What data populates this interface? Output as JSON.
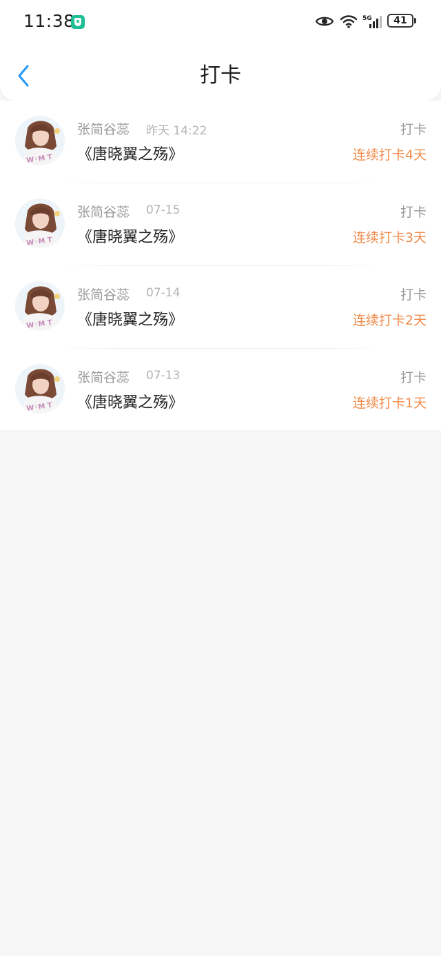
{
  "status_bar": {
    "time": "11:38",
    "network": "5G",
    "battery": "41",
    "icons": [
      "shield-check-icon",
      "eye-icon",
      "wifi-icon",
      "signal-icon",
      "battery-icon"
    ]
  },
  "header": {
    "title": "打卡",
    "back_icon": "chevron-left-icon"
  },
  "colors": {
    "accent": "#f08b4b",
    "back_arrow": "#2b9af3",
    "muted_text": "#9a9a9a",
    "page_bg": "#f7f6f7"
  },
  "items": [
    {
      "user": "张简谷蕊",
      "time": "昨天 14:22",
      "book": "《唐晓翼之殇》",
      "type": "打卡",
      "streak": "连续打卡4天"
    },
    {
      "user": "张简谷蕊",
      "time": "07-15",
      "book": "《唐晓翼之殇》",
      "type": "打卡",
      "streak": "连续打卡3天"
    },
    {
      "user": "张简谷蕊",
      "time": "07-14",
      "book": "《唐晓翼之殇》",
      "type": "打卡",
      "streak": "连续打卡2天"
    },
    {
      "user": "张简谷蕊",
      "time": "07-13",
      "book": "《唐晓翼之殇》",
      "type": "打卡",
      "streak": "连续打卡1天"
    }
  ]
}
